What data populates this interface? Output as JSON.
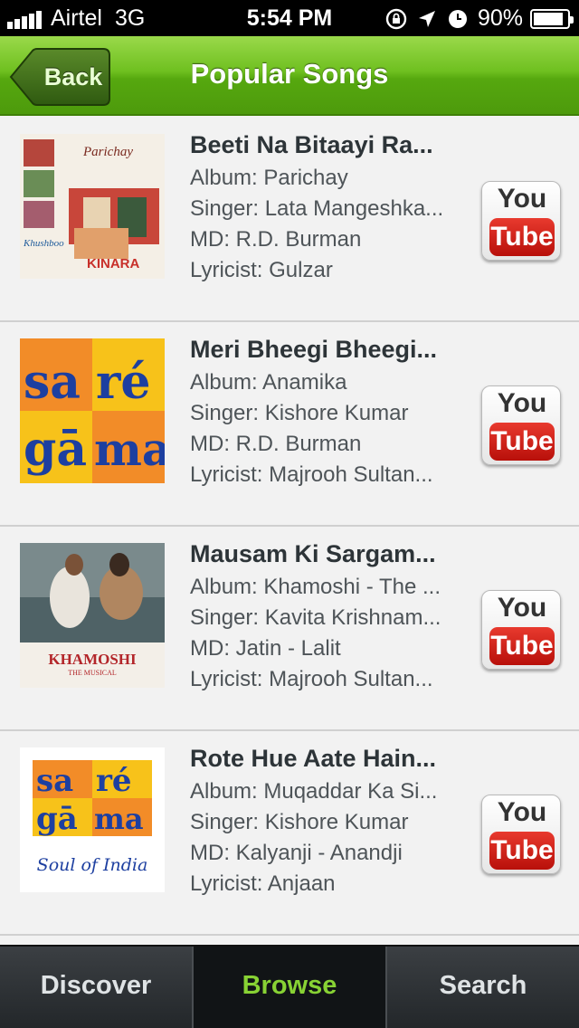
{
  "status_bar": {
    "carrier": "Airtel",
    "network": "3G",
    "time": "5:54 PM",
    "battery_text": "90%",
    "battery_level": 0.9
  },
  "navbar": {
    "back_label": "Back",
    "title": "Popular Songs"
  },
  "songs": [
    {
      "title": "Beeti Na Bitaayi Ra...",
      "album": "Album: Parichay",
      "singer": "Singer: Lata Mangeshka...",
      "md": "MD: R.D. Burman",
      "lyricist": "Lyricist: Gulzar",
      "thumb": "parichay-album-cover",
      "thumb_text": [
        "Parichay",
        "Khushboo",
        "KINARA"
      ]
    },
    {
      "title": "Meri Bheegi Bheegi...",
      "album": "Album: Anamika",
      "singer": "Singer: Kishore Kumar",
      "md": "MD: R.D. Burman",
      "lyricist": "Lyricist: Majrooh Sultan...",
      "thumb": "saregama-logo",
      "thumb_text": [
        "sa",
        "ré",
        "gā",
        "ma"
      ]
    },
    {
      "title": "Mausam Ki Sargam...",
      "album": "Album: Khamoshi - The ...",
      "singer": "Singer: Kavita Krishnam...",
      "md": "MD: Jatin - Lalit",
      "lyricist": "Lyricist: Majrooh Sultan...",
      "thumb": "khamoshi-album-cover",
      "thumb_text": [
        "KHAMOSHI",
        "THE MUSICAL"
      ]
    },
    {
      "title": "Rote Hue Aate Hain...",
      "album": "Album: Muqaddar Ka Si...",
      "singer": "Singer: Kishore Kumar",
      "md": "MD: Kalyanji - Anandji",
      "lyricist": "Lyricist: Anjaan",
      "thumb": "saregama-soul-of-india-logo",
      "thumb_text": [
        "sa",
        "ré",
        "gā",
        "ma",
        "Soul of India"
      ]
    }
  ],
  "youtube_button": {
    "you": "You",
    "tube": "Tube"
  },
  "tabs": [
    {
      "label": "Discover",
      "active": false
    },
    {
      "label": "Browse",
      "active": true
    },
    {
      "label": "Search",
      "active": false
    }
  ],
  "colors": {
    "nav_green": "#6fc020",
    "active_tab": "#88d234",
    "youtube_red": "#d0231b",
    "saregama_orange": "#f28c28",
    "saregama_blue": "#1d3fa0",
    "saregama_yellow": "#f7c21a"
  }
}
